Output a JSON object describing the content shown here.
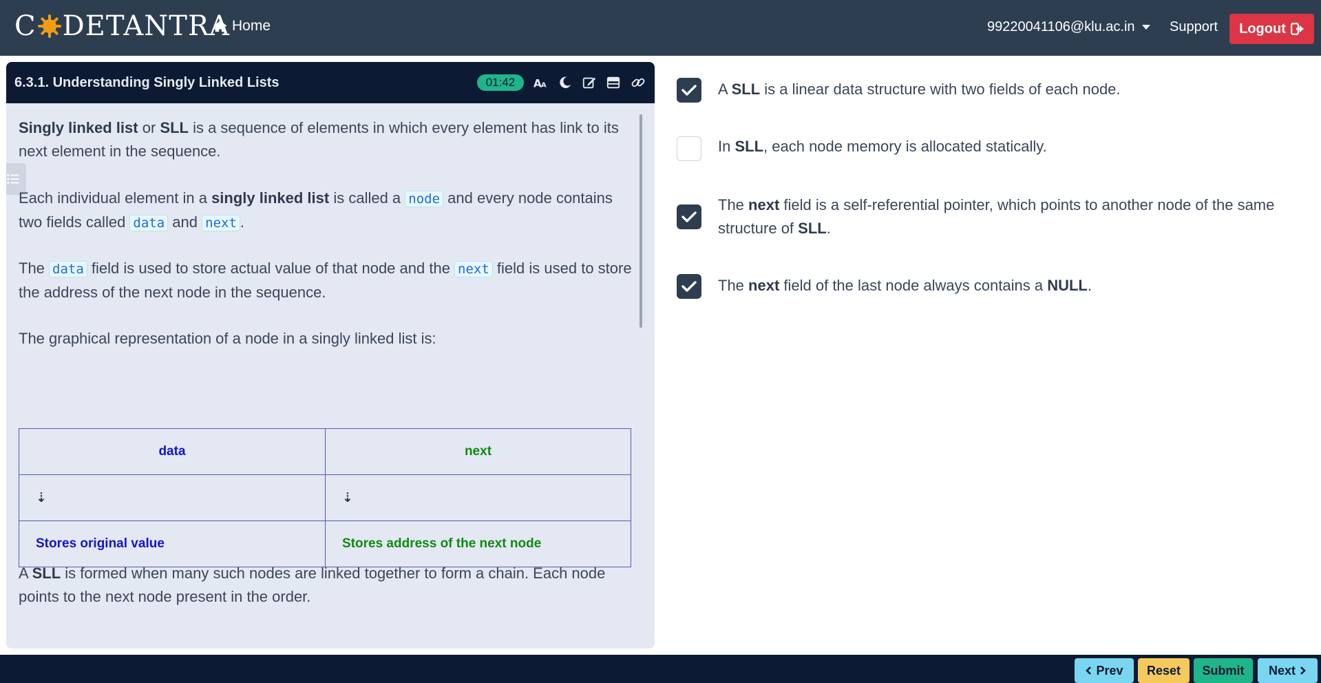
{
  "navbar": {
    "logo_parts": [
      "C",
      "DETANTRA"
    ],
    "home_label": "Home",
    "user_email": "99220041106@klu.ac.in",
    "support_label": "Support",
    "logout_label": "Logout"
  },
  "lesson": {
    "title": "6.3.1. Understanding Singly Linked Lists",
    "timer": "01:42",
    "p1": {
      "b1": "Singly linked list",
      "t1": " or ",
      "b2": "SLL",
      "t2": " is a sequence of elements in which every element has link to its next element in the sequence."
    },
    "p2": {
      "t1": "Each individual element in a ",
      "b1": "singly linked list",
      "t2": " is called a ",
      "c1": "node",
      "t3": " and every node contains two fields called ",
      "c2": "data",
      "t4": " and ",
      "c3": "next",
      "t5": "."
    },
    "p3": {
      "t1": "The ",
      "c1": "data",
      "t2": " field is used to store actual value of that node and the ",
      "c2": "next",
      "t3": " field is used to store the address of the next node in the sequence."
    },
    "p4": "The graphical representation of a node in a singly linked list is:",
    "table": {
      "header": [
        "data",
        "next"
      ],
      "arrows": [
        "⇣",
        "⇣"
      ],
      "descriptions": [
        "Stores original value",
        "Stores address of the next node"
      ]
    },
    "p5": {
      "t1": "A ",
      "b1": "SLL",
      "t2": " is formed when many such nodes are linked together to form a chain. Each node points to the next node present in the order."
    }
  },
  "options": [
    {
      "checked": true,
      "t1": "A ",
      "b1": "SLL",
      "t2": " is a linear data structure with two fields of each node."
    },
    {
      "checked": false,
      "t1": "In ",
      "b1": "SLL",
      "t2": ", each node memory is allocated statically."
    },
    {
      "checked": true,
      "t1": "The ",
      "b1": "next",
      "t2": " field is a self-referential pointer, which points to another node of the same structure of ",
      "b2": "SLL",
      "t3": "."
    },
    {
      "checked": true,
      "t1": "The ",
      "b1": "next",
      "t2": " field of the last node always contains a ",
      "b2": "NULL",
      "t3": "."
    }
  ],
  "footer": {
    "prev_label": "Prev",
    "reset_label": "Reset",
    "submit_label": "Submit",
    "next_label": "Next"
  },
  "colors": {
    "navbar_bg": "#2d3e50",
    "panel_header_bg": "#0c1a33",
    "panel_bg": "#e4e8f3",
    "logout_red": "#dc3545",
    "timer_green": "#1fb58a",
    "logo_sun": "#f39c12"
  },
  "icons": [
    "home-icon",
    "logout-icon",
    "font-size-icon",
    "moon-icon",
    "edit-icon",
    "layout-icon",
    "link-icon",
    "list-icon",
    "check-icon",
    "chevron-left-icon",
    "chevron-right-icon"
  ]
}
